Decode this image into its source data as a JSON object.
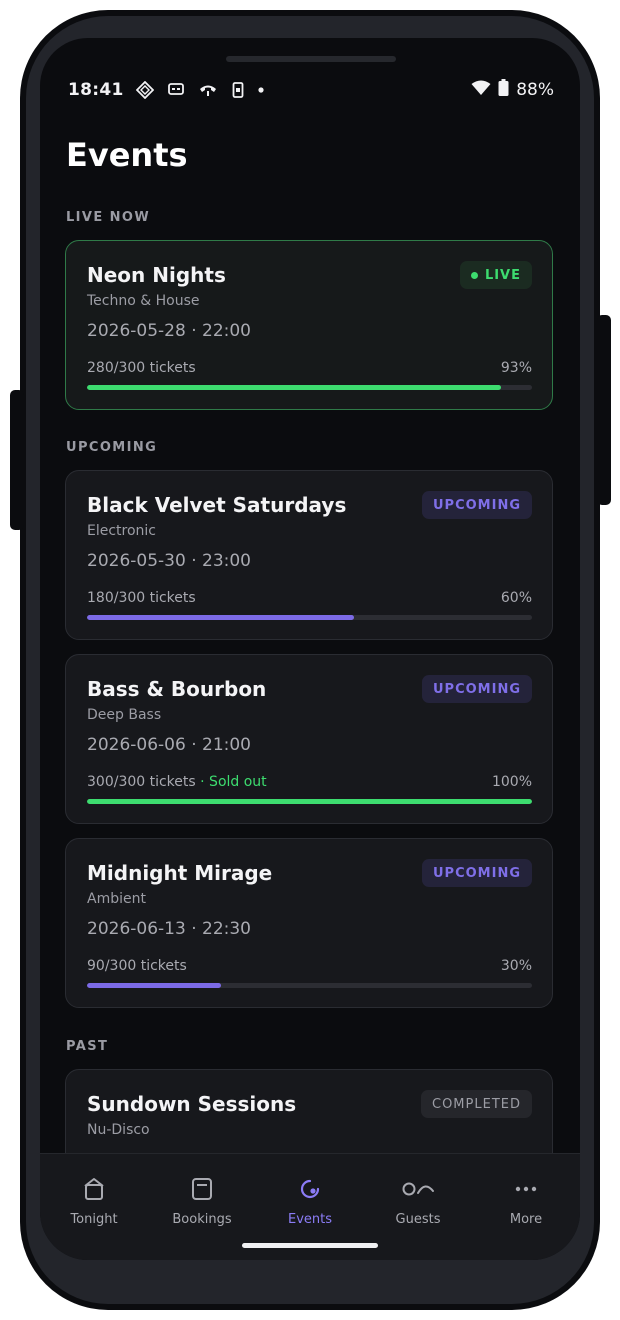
{
  "status_bar": {
    "time": "18:41",
    "battery": "88%",
    "left_icons": [
      "diamond-grid-icon",
      "message-icon",
      "phone-call-icon",
      "phone-screen-icon",
      "dot-icon"
    ],
    "right_icons": [
      "wifi-icon",
      "battery-icon"
    ]
  },
  "page": {
    "title": "Events"
  },
  "sections": {
    "live": "LIVE NOW",
    "upcoming": "UPCOMING",
    "past": "PAST"
  },
  "events": [
    {
      "name": "Neon Nights",
      "genre": "Techno & House",
      "datetime": "2026-05-28 · 22:00",
      "tickets": "280/300 tickets",
      "sold_out": "",
      "percent_text": "93%",
      "progress": 0.93,
      "badge": "LIVE",
      "bar_color": "#3ddc6f"
    },
    {
      "name": "Black Velvet Saturdays",
      "genre": "Electronic",
      "datetime": "2026-05-30 · 23:00",
      "tickets": "180/300 tickets",
      "sold_out": "",
      "percent_text": "60%",
      "progress": 0.6,
      "badge": "UPCOMING",
      "bar_color": "#7c6ae6"
    },
    {
      "name": "Bass & Bourbon",
      "genre": "Deep Bass",
      "datetime": "2026-06-06 · 21:00",
      "tickets": "300/300 tickets",
      "sold_out": " · Sold out",
      "percent_text": "100%",
      "progress": 1.0,
      "badge": "UPCOMING",
      "bar_color": "#3ddc6f"
    },
    {
      "name": "Midnight Mirage",
      "genre": "Ambient",
      "datetime": "2026-06-13 · 22:30",
      "tickets": "90/300 tickets",
      "sold_out": "",
      "percent_text": "30%",
      "progress": 0.3,
      "badge": "UPCOMING",
      "bar_color": "#7c6ae6"
    },
    {
      "name": "Sundown Sessions",
      "genre": "Nu-Disco",
      "badge": "COMPLETED"
    }
  ],
  "nav": [
    {
      "label": "Tonight",
      "icon": "home-icon",
      "active": false
    },
    {
      "label": "Bookings",
      "icon": "bookings-icon",
      "active": false
    },
    {
      "label": "Events",
      "icon": "events-icon",
      "active": true
    },
    {
      "label": "Guests",
      "icon": "guests-icon",
      "active": false
    },
    {
      "label": "More",
      "icon": "more-icon",
      "active": false
    }
  ],
  "colors": {
    "accent": "#8b7cf6",
    "live_green": "#3ddc6f",
    "background": "#0b0c0f",
    "card": "#17181c"
  }
}
